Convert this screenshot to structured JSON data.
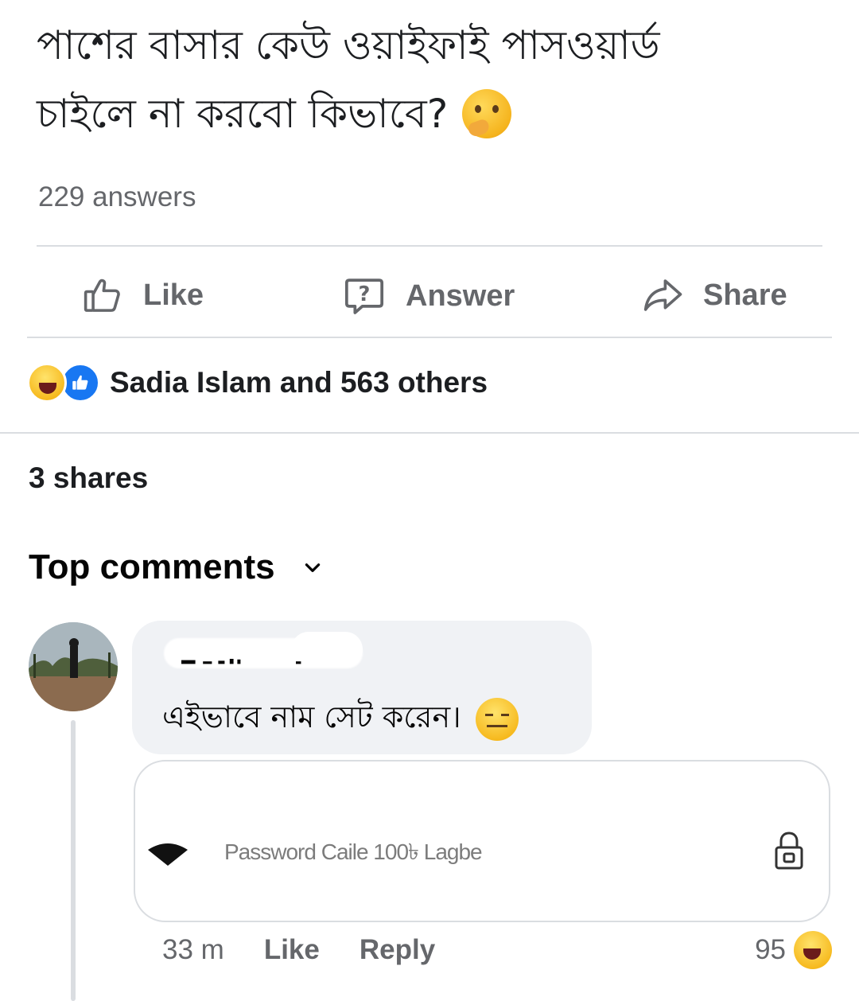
{
  "post": {
    "question_line1": "পাশের বাসার কেউ ওয়াইফাই পাসওয়ার্ড",
    "question_line2": "চাইলে না করবো কিভাবে?",
    "question_emoji": "thinking-face-emoji",
    "answers_count": "229 answers"
  },
  "actions": {
    "like_label": "Like",
    "answer_label": "Answer",
    "share_label": "Share"
  },
  "reactions": {
    "summary": "Sadia Islam and 563 others",
    "icons": [
      "haha-reaction-icon",
      "like-reaction-icon"
    ]
  },
  "shares": "3 shares",
  "comments_section": {
    "sort_label": "Top comments"
  },
  "comment": {
    "author_name_obscured": "",
    "text": "এইভাবে নাম সেট করেন।",
    "emoji": "expressionless-face-emoji",
    "attachment": {
      "wifi_network_name": "Password Caile 100৳ Lagbe",
      "icons": [
        "wifi-icon",
        "lock-icon"
      ]
    },
    "time": "33 m",
    "like_label": "Like",
    "reply_label": "Reply",
    "reaction_count": "95"
  },
  "colors": {
    "text_primary": "#050505",
    "text_secondary": "#65676b",
    "divider": "#dadde1",
    "bubble_bg": "#f0f2f5",
    "like_blue": "#1877f2"
  }
}
